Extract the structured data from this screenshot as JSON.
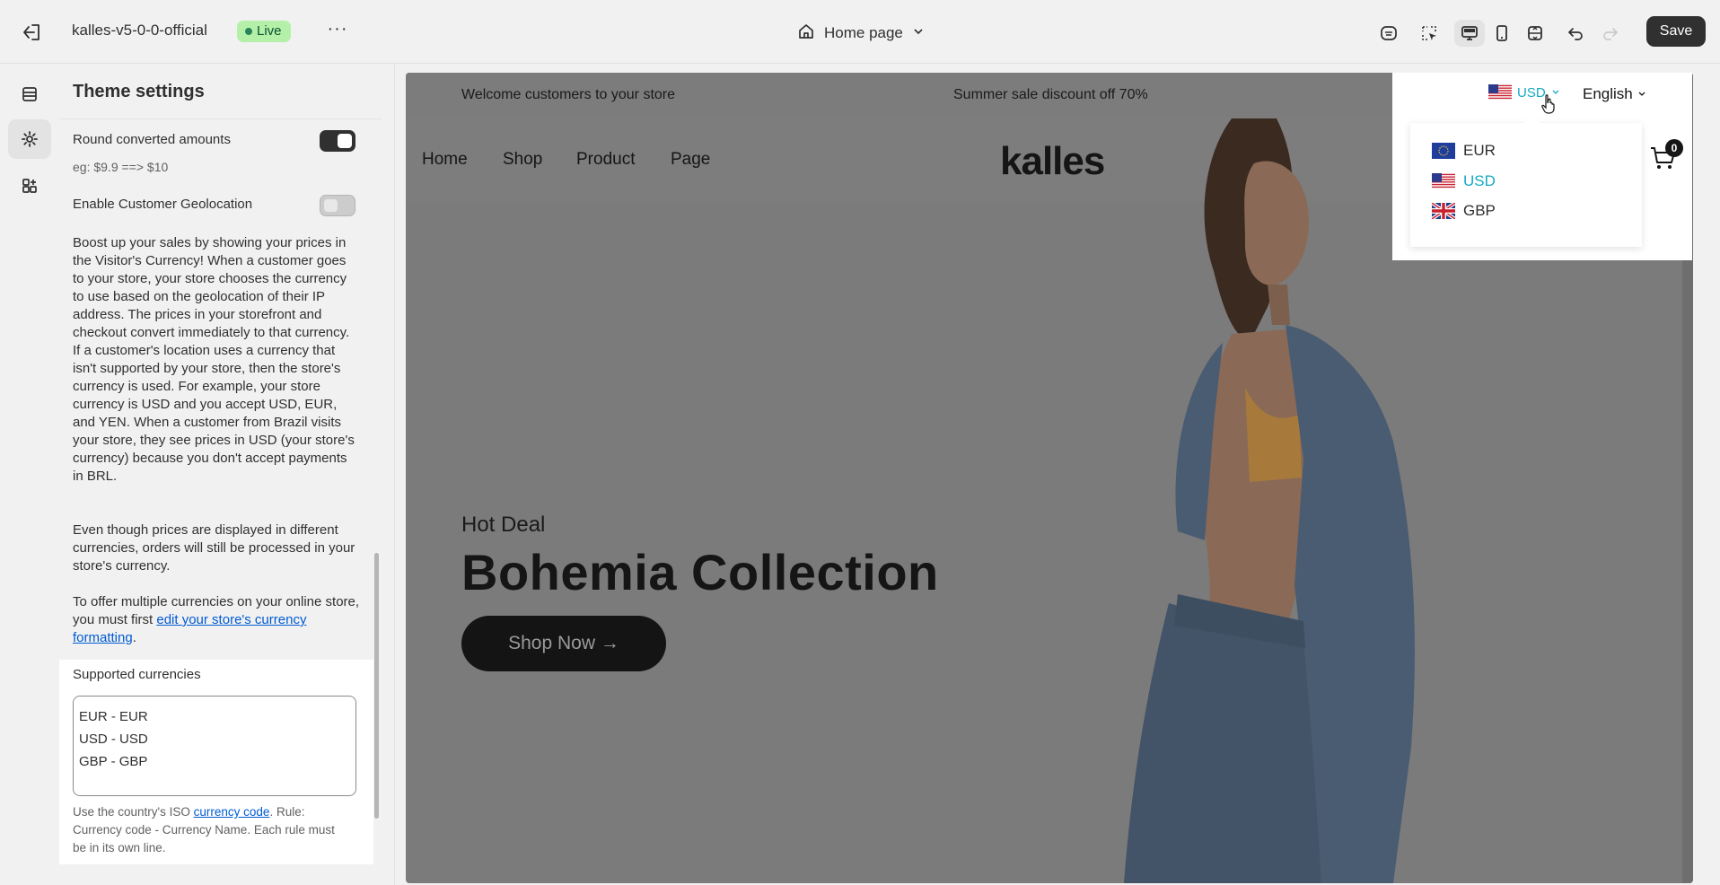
{
  "topbar": {
    "store_name": "kalles-v5-0-0-official",
    "live_badge": "Live",
    "page_selector": "Home page",
    "save_label": "Save"
  },
  "sidebar": {
    "title": "Theme settings",
    "round_amounts": {
      "label": "Round converted amounts",
      "hint": "eg: $9.9 ==> $10",
      "enabled": true
    },
    "geolocation": {
      "label": "Enable Customer Geolocation",
      "enabled": false
    },
    "description_1": "Boost up your sales by showing your prices in the Visitor's Currency! When a customer goes to your store, your store chooses the currency to use based on the geolocation of their IP address. The prices in your storefront and checkout convert immediately to that currency. If a customer's location uses a currency that isn't supported by your store, then the store's currency is used. For example, your store currency is USD and you accept USD, EUR, and YEN. When a customer from Brazil visits your store, they see prices in USD (your store's currency) because you don't accept payments in BRL.",
    "description_2": "Even though prices are displayed in different currencies, orders will still be processed in your store's currency.",
    "description_3": "To offer multiple currencies on your online store, you must first",
    "description_link": "edit your store's currency formatting",
    "description_end": ".",
    "supported": {
      "title": "Supported currencies",
      "lines": [
        "EUR - EUR",
        "USD - USD",
        "GBP - GBP"
      ],
      "help_prefix": "Use the country's ISO ",
      "help_link": "currency code",
      "help_suffix": ". Rule: Currency code - Currency Name. Each rule must be in its own line."
    }
  },
  "preview": {
    "announcement_left": "Welcome customers to your store",
    "announcement_center": "Summer sale discount off 70%",
    "nav": [
      "Home",
      "Shop",
      "Product",
      "Page"
    ],
    "logo": "kalles",
    "hero_kicker": "Hot Deal",
    "hero_title": "Bohemia Collection",
    "hero_button": "Shop Now →",
    "cart_count": "0",
    "currency_selected": "USD",
    "language": "English",
    "currency_options": [
      {
        "code": "EUR",
        "flag": "eu-flag-icon"
      },
      {
        "code": "USD",
        "flag": "us-flag-icon"
      },
      {
        "code": "GBP",
        "flag": "uk-flag-icon"
      }
    ],
    "colors": {
      "accent": "#12aac3"
    }
  }
}
